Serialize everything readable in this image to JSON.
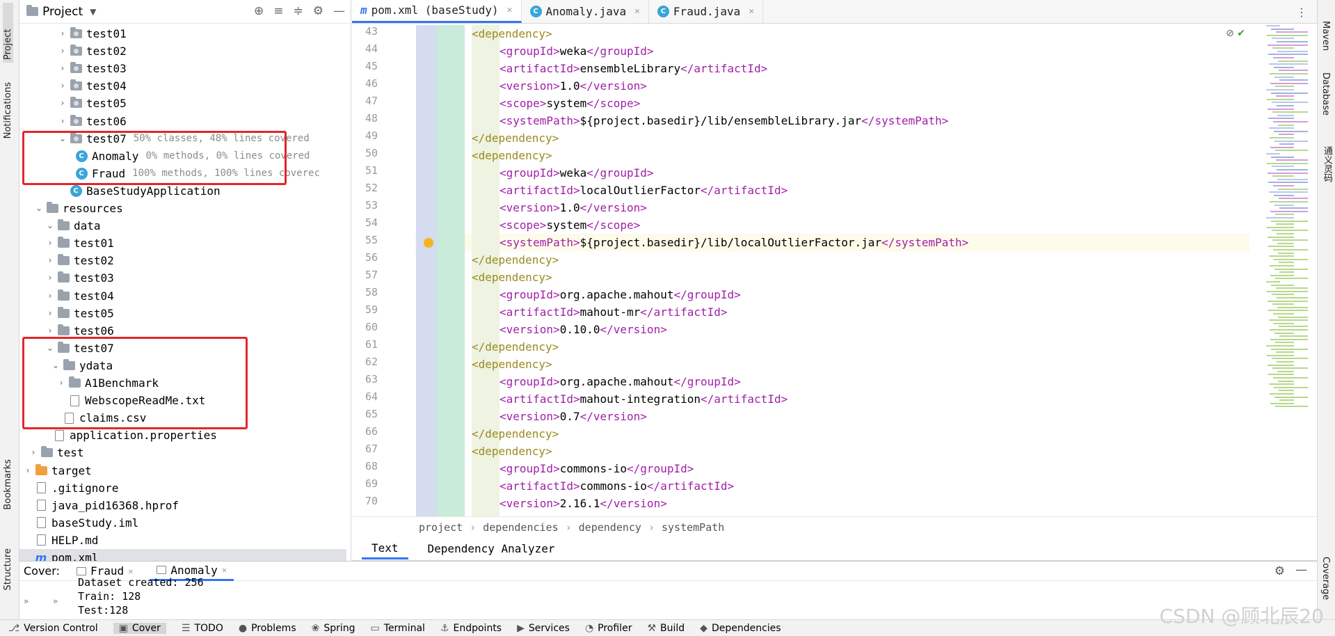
{
  "left_strip": {
    "project": "Project",
    "notifications": "Notifications",
    "bookmarks": "Bookmarks",
    "structure": "Structure"
  },
  "right_strip": {
    "maven": "Maven",
    "database": "Database",
    "tongyi": "通义灵码",
    "coverage": "Coverage"
  },
  "project_panel": {
    "title": "Project",
    "rows": [
      {
        "label": "test01",
        "hint": ""
      },
      {
        "label": "test02",
        "hint": ""
      },
      {
        "label": "test03",
        "hint": ""
      },
      {
        "label": "test04",
        "hint": ""
      },
      {
        "label": "test05",
        "hint": ""
      },
      {
        "label": "test06",
        "hint": ""
      },
      {
        "label": "test07",
        "hint": "50% classes, 48% lines covered"
      },
      {
        "label": "Anomaly",
        "hint": "0% methods, 0% lines covered"
      },
      {
        "label": "Fraud",
        "hint": "100% methods, 100% lines coverec"
      },
      {
        "label": "BaseStudyApplication",
        "hint": ""
      },
      {
        "label": "resources",
        "hint": ""
      },
      {
        "label": "data",
        "hint": ""
      },
      {
        "label": "test01",
        "hint": ""
      },
      {
        "label": "test02",
        "hint": ""
      },
      {
        "label": "test03",
        "hint": ""
      },
      {
        "label": "test04",
        "hint": ""
      },
      {
        "label": "test05",
        "hint": ""
      },
      {
        "label": "test06",
        "hint": ""
      },
      {
        "label": "test07",
        "hint": ""
      },
      {
        "label": "ydata",
        "hint": ""
      },
      {
        "label": "A1Benchmark",
        "hint": ""
      },
      {
        "label": "WebscopeReadMe.txt",
        "hint": ""
      },
      {
        "label": "claims.csv",
        "hint": ""
      },
      {
        "label": "application.properties",
        "hint": ""
      },
      {
        "label": "test",
        "hint": ""
      },
      {
        "label": "target",
        "hint": ""
      },
      {
        "label": ".gitignore",
        "hint": ""
      },
      {
        "label": "java_pid16368.hprof",
        "hint": ""
      },
      {
        "label": "baseStudy.iml",
        "hint": ""
      },
      {
        "label": "HELP.md",
        "hint": ""
      },
      {
        "label": "pom.xml",
        "hint": ""
      }
    ]
  },
  "editor": {
    "tabs": [
      {
        "icon": "m",
        "label": "pom.xml (baseStudy)"
      },
      {
        "icon": "C",
        "label": "Anomaly.java"
      },
      {
        "icon": "C",
        "label": "Fraud.java"
      }
    ],
    "lines": [
      {
        "n": "43",
        "text": "<dependency>"
      },
      {
        "n": "44",
        "text": "<groupId>weka</groupId>"
      },
      {
        "n": "45",
        "text": "<artifactId>ensembleLibrary</artifactId>"
      },
      {
        "n": "46",
        "text": "<version>1.0</version>"
      },
      {
        "n": "47",
        "text": "<scope>system</scope>"
      },
      {
        "n": "48",
        "text": "<systemPath>${project.basedir}/lib/ensembleLibrary.jar</systemPath>"
      },
      {
        "n": "49",
        "text": "</dependency>"
      },
      {
        "n": "50",
        "text": "<dependency>"
      },
      {
        "n": "51",
        "text": "<groupId>weka</groupId>"
      },
      {
        "n": "52",
        "text": "<artifactId>localOutlierFactor</artifactId>"
      },
      {
        "n": "53",
        "text": "<version>1.0</version>"
      },
      {
        "n": "54",
        "text": "<scope>system</scope>"
      },
      {
        "n": "55",
        "text": "<systemPath>${project.basedir}/lib/localOutlierFactor.jar</systemPath>"
      },
      {
        "n": "56",
        "text": "</dependency>"
      },
      {
        "n": "57",
        "text": "<dependency>"
      },
      {
        "n": "58",
        "text": "<groupId>org.apache.mahout</groupId>"
      },
      {
        "n": "59",
        "text": "<artifactId>mahout-mr</artifactId>"
      },
      {
        "n": "60",
        "text": "<version>0.10.0</version>"
      },
      {
        "n": "61",
        "text": "</dependency>"
      },
      {
        "n": "62",
        "text": "<dependency>"
      },
      {
        "n": "63",
        "text": "<groupId>org.apache.mahout</groupId>"
      },
      {
        "n": "64",
        "text": "<artifactId>mahout-integration</artifactId>"
      },
      {
        "n": "65",
        "text": "<version>0.7</version>"
      },
      {
        "n": "66",
        "text": "</dependency>"
      },
      {
        "n": "67",
        "text": "<dependency>"
      },
      {
        "n": "68",
        "text": "<groupId>commons-io</groupId>"
      },
      {
        "n": "69",
        "text": "<artifactId>commons-io</artifactId>"
      },
      {
        "n": "70",
        "text": "<version>2.16.1</version>"
      }
    ],
    "breadcrumb": [
      "project",
      "dependencies",
      "dependency",
      "systemPath"
    ],
    "bottom_tabs": [
      "Text",
      "Dependency Analyzer"
    ]
  },
  "cover_panel": {
    "label": "Cover:",
    "tabs": [
      "Fraud",
      "Anomaly"
    ],
    "output": [
      "Dataset created: 256",
      "Train: 128",
      "Test:128"
    ]
  },
  "status_bar": [
    "Version Control",
    "Cover",
    "TODO",
    "Problems",
    "Spring",
    "Terminal",
    "Endpoints",
    "Services",
    "Profiler",
    "Build",
    "Dependencies"
  ],
  "watermark": "CSDN @顾北辰20"
}
